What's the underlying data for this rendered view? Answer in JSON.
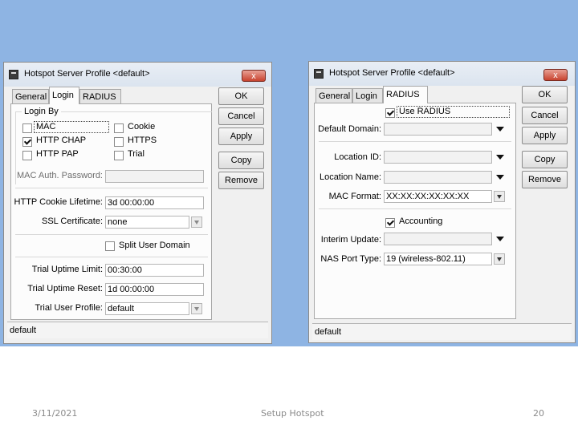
{
  "slide": {
    "date": "3/11/2021",
    "footer_title": "Setup Hotspot",
    "page_number": "20",
    "background_color": "#8eb4e3"
  },
  "left_window": {
    "title": "Hotspot Server Profile <default>",
    "close_glyph": "x",
    "tabs": [
      "General",
      "Login",
      "RADIUS"
    ],
    "active_tab": "Login",
    "login_by": {
      "legend": "Login By",
      "options": [
        {
          "label": "MAC",
          "checked": false
        },
        {
          "label": "Cookie",
          "checked": false
        },
        {
          "label": "HTTP CHAP",
          "checked": true
        },
        {
          "label": "HTTPS",
          "checked": false
        },
        {
          "label": "HTTP PAP",
          "checked": false
        },
        {
          "label": "Trial",
          "checked": false
        }
      ]
    },
    "fields": {
      "mac_auth_password": {
        "label": "MAC Auth. Password:",
        "value": ""
      },
      "http_cookie_lifetime": {
        "label": "HTTP Cookie Lifetime:",
        "value": "3d 00:00:00"
      },
      "ssl_certificate": {
        "label": "SSL Certificate:",
        "value": "none"
      },
      "split_user_domain": {
        "label": "Split User Domain",
        "checked": false
      },
      "trial_uptime_limit": {
        "label": "Trial Uptime Limit:",
        "value": "00:30:00"
      },
      "trial_uptime_reset": {
        "label": "Trial Uptime Reset:",
        "value": "1d 00:00:00"
      },
      "trial_user_profile": {
        "label": "Trial User Profile:",
        "value": "default"
      }
    },
    "buttons": [
      "OK",
      "Cancel",
      "Apply",
      "Copy",
      "Remove"
    ],
    "status": "default"
  },
  "right_window": {
    "title": "Hotspot Server Profile <default>",
    "close_glyph": "x",
    "tabs": [
      "General",
      "Login",
      "RADIUS"
    ],
    "active_tab": "RADIUS",
    "use_radius": {
      "label": "Use RADIUS",
      "checked": true
    },
    "fields": {
      "default_domain": {
        "label": "Default Domain:",
        "value": ""
      },
      "location_id": {
        "label": "Location ID:",
        "value": ""
      },
      "location_name": {
        "label": "Location Name:",
        "value": ""
      },
      "mac_format": {
        "label": "MAC Format:",
        "value": "XX:XX:XX:XX:XX:XX"
      },
      "accounting": {
        "label": "Accounting",
        "checked": true
      },
      "interim_update": {
        "label": "Interim Update:",
        "value": ""
      },
      "nas_port_type": {
        "label": "NAS Port Type:",
        "value": "19 (wireless-802.11)"
      }
    },
    "buttons": [
      "OK",
      "Cancel",
      "Apply",
      "Copy",
      "Remove"
    ],
    "status": "default"
  }
}
